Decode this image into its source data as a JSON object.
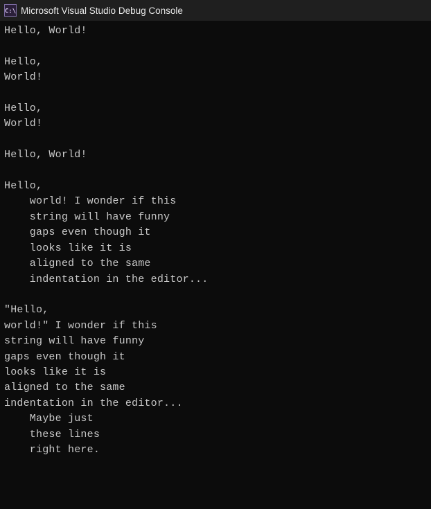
{
  "titlebar": {
    "title": "Microsoft Visual Studio Debug Console"
  },
  "console": {
    "lines": [
      "Hello, World!",
      "",
      "Hello,",
      "World!",
      "",
      "Hello,",
      "World!",
      "",
      "Hello, World!",
      "",
      "Hello,",
      "    world! I wonder if this",
      "    string will have funny",
      "    gaps even though it",
      "    looks like it is",
      "    aligned to the same",
      "    indentation in the editor...",
      "",
      "\"Hello,",
      "world!\" I wonder if this",
      "string will have funny",
      "gaps even though it",
      "looks like it is",
      "aligned to the same",
      "indentation in the editor...",
      "    Maybe just",
      "    these lines",
      "    right here."
    ]
  }
}
